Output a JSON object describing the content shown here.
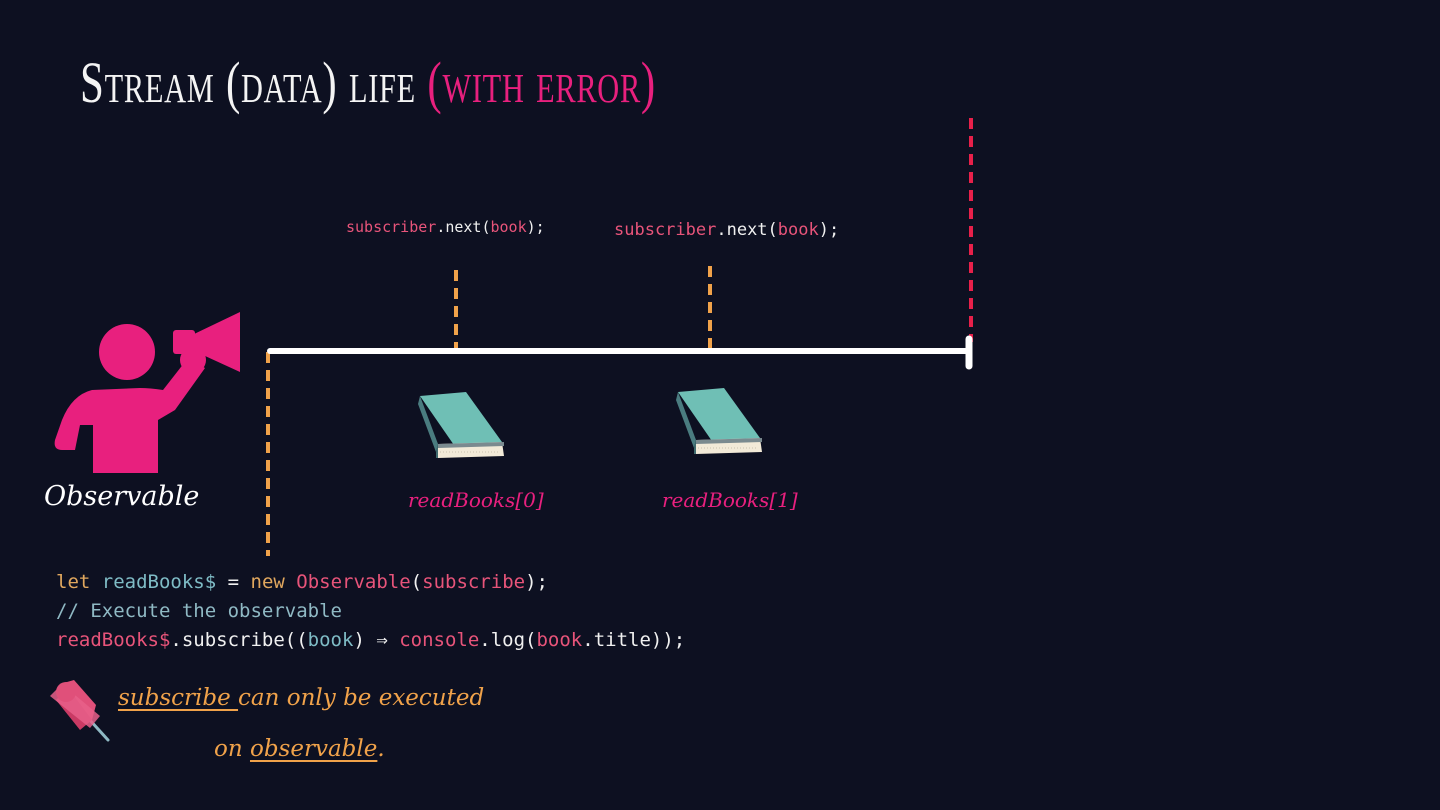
{
  "title": {
    "main": "Stream (data) life",
    "accent": "(with error)"
  },
  "emissions": [
    {
      "object": "subscriber",
      "method": ".next(",
      "arg": "book",
      "end": ");"
    },
    {
      "object": "subscriber",
      "method": ".next(",
      "arg": "book",
      "end": ");"
    }
  ],
  "observable_label": "Observable",
  "items": [
    {
      "label": "readBooks[0]"
    },
    {
      "label": "readBooks[1]"
    }
  ],
  "code": {
    "line1": {
      "kw": "let",
      "var": "readBooks$",
      "eq": " = ",
      "new": "new",
      "cls": "Observable",
      "open": "(",
      "arg": "subscribe",
      "close": ");"
    },
    "line2": "// Execute the observable",
    "line3": {
      "obj": "readBooks$",
      "method": ".subscribe((",
      "param": "book",
      "arrow": ") ⇒ ",
      "call": "console",
      "call_method": ".log(",
      "call_arg": "book",
      "tail": ".title));"
    }
  },
  "note": {
    "word1": "subscribe ",
    "text1": "can only be executed",
    "text2": "on ",
    "word2": "observable",
    "end": "."
  },
  "colors": {
    "background": "#0d1021",
    "accent_pink": "#e8207e",
    "timeline": "#ffffff",
    "tick_orange": "#f0a24a",
    "error_red": "#e8204a",
    "book_teal": "#6fbfb5"
  },
  "icons": {
    "announcer": "person-megaphone-icon",
    "book": "book-icon",
    "pin": "pushpin-icon"
  }
}
